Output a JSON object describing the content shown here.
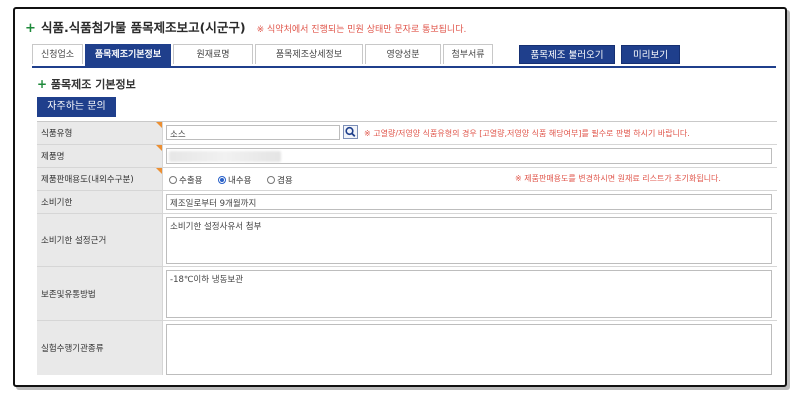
{
  "header": {
    "plus": "+",
    "title": "식품.식품첨가물 품목제조보고(시군구)",
    "notice": "※ 식약처에서 진행되는 민원 상태만 문자로 통보됩니다."
  },
  "tabs": [
    {
      "label": "신청업소",
      "active": false
    },
    {
      "label": "품목제조기본정보",
      "active": true
    },
    {
      "label": "원재료명",
      "active": false
    },
    {
      "label": "품목제조상세정보",
      "active": false
    },
    {
      "label": "영양성분",
      "active": false
    },
    {
      "label": "첨부서류",
      "active": false
    }
  ],
  "buttons": {
    "load": "품목제조 불러오기",
    "preview": "미리보기",
    "faq": "자주하는 문의"
  },
  "section": {
    "plus": "+",
    "title": "품목제조 기본정보"
  },
  "form": {
    "food_type": {
      "label": "식품유형",
      "value": "소스",
      "note": "※ 고열량/저영양 식품유형의 경우 [고열량,저영양 식품 해당여부]를 필수로 판별 하시기 바랍니다."
    },
    "product_name": {
      "label": "제품명",
      "value": ""
    },
    "sales_use": {
      "label": "제품판매용도(내외수구분)",
      "options": [
        "수출용",
        "내수용",
        "겸용"
      ],
      "selected": "내수용",
      "note": "※ 제품판매용도를 변경하시면 원재료 리스트가 초기화됩니다."
    },
    "shelf_life": {
      "label": "소비기한",
      "value": "제조일로부터 9개월까지"
    },
    "shelf_life_basis": {
      "label": "소비기한 설정근거",
      "value": "소비기한 설정사유서 첨부"
    },
    "storage": {
      "label": "보존및유통방법",
      "value": "-18℃이하 냉동보관"
    },
    "test_agency": {
      "label": "실험수행기관종류",
      "value": ""
    }
  }
}
